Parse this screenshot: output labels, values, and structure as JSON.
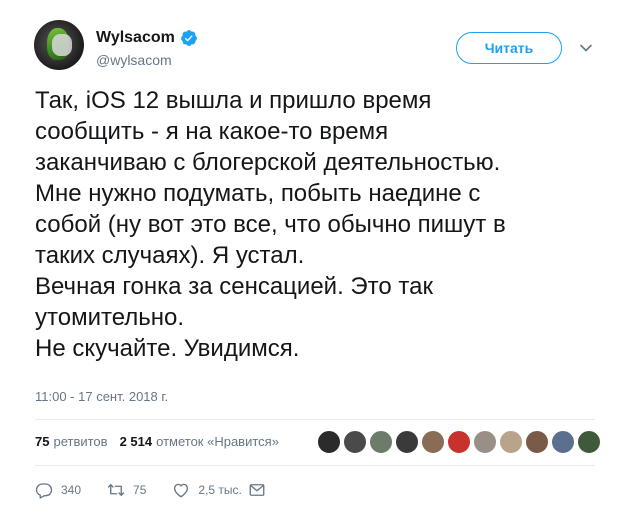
{
  "author": {
    "name": "Wylsacom",
    "handle": "@wylsacom",
    "avatar_icon": "avatar-photo",
    "verified_color": "#1da1f2"
  },
  "follow_button": {
    "label": "Читать"
  },
  "tweet": {
    "text": "Так, iOS 12 вышла и пришло время\nсообщить - я на какое-то время\nзаканчиваю с блогерской деятельностью.\nМне нужно подумать, побыть наедине с\nсобой (ну вот это все, что обычно пишут в\nтаких случаях). Я устал.\nВечная гонка за сенсацией. Это так\nутомительно.\nНе скучайте. Увидимся.",
    "timestamp": "11:00 - 17 сент. 2018 г."
  },
  "stats": {
    "retweets_count": "75",
    "retweets_label": "ретвитов",
    "likes_count": "2 514",
    "likes_label": "отметок «Нравится»",
    "face_colors": [
      "#2b2b2b",
      "#4a4a4a",
      "#6d7b6a",
      "#3a3a3a",
      "#8a6b55",
      "#c8322c",
      "#9a8f86",
      "#b8a48a",
      "#7a5b48",
      "#5b6f8f",
      "#3f5a3a"
    ]
  },
  "actions": {
    "replies": "340",
    "retweets": "75",
    "likes": "2,5 тыс.",
    "accent": "#657786"
  }
}
